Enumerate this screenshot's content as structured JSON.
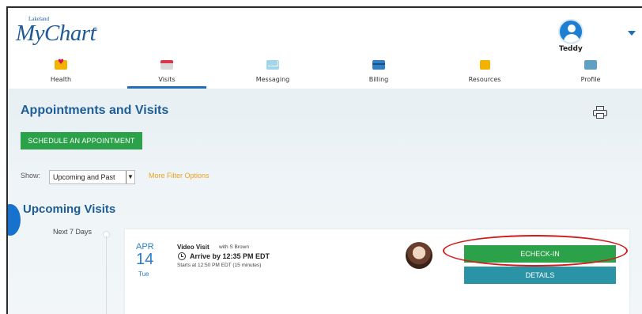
{
  "brand": {
    "small": "Lakeland",
    "name": "MyChart",
    "tm": "®"
  },
  "user": {
    "name": "Teddy"
  },
  "nav": [
    {
      "label": "Health",
      "icon": "heart-folder-icon"
    },
    {
      "label": "Visits",
      "icon": "calendar-icon",
      "active": true
    },
    {
      "label": "Messaging",
      "icon": "envelope-icon"
    },
    {
      "label": "Billing",
      "icon": "credit-card-icon"
    },
    {
      "label": "Resources",
      "icon": "book-icon"
    },
    {
      "label": "Profile",
      "icon": "id-card-icon"
    }
  ],
  "page": {
    "title": "Appointments and Visits",
    "schedule_button": "SCHEDULE AN APPOINTMENT",
    "show_label": "Show:",
    "filter_value": "Upcoming and Past",
    "more_filter": "More Filter Options",
    "section_title": "Upcoming Visits",
    "group_label": "Next 7 Days"
  },
  "visit": {
    "month": "APR",
    "day": "14",
    "dow": "Tue",
    "type": "Video Visit",
    "provider": "with S Brown",
    "arrive": "Arrive by 12:35 PM EDT",
    "starts": "Starts at 12:50 PM EDT (15 minutes)",
    "echeckin_label": "ECHECK-IN",
    "details_label": "DETAILS"
  },
  "colors": {
    "brand_blue": "#1f5d96",
    "green_button": "#2ba24a",
    "teal_button": "#2a94a6",
    "accent_orange": "#f0a21a",
    "highlight_red": "#d11a1a"
  }
}
